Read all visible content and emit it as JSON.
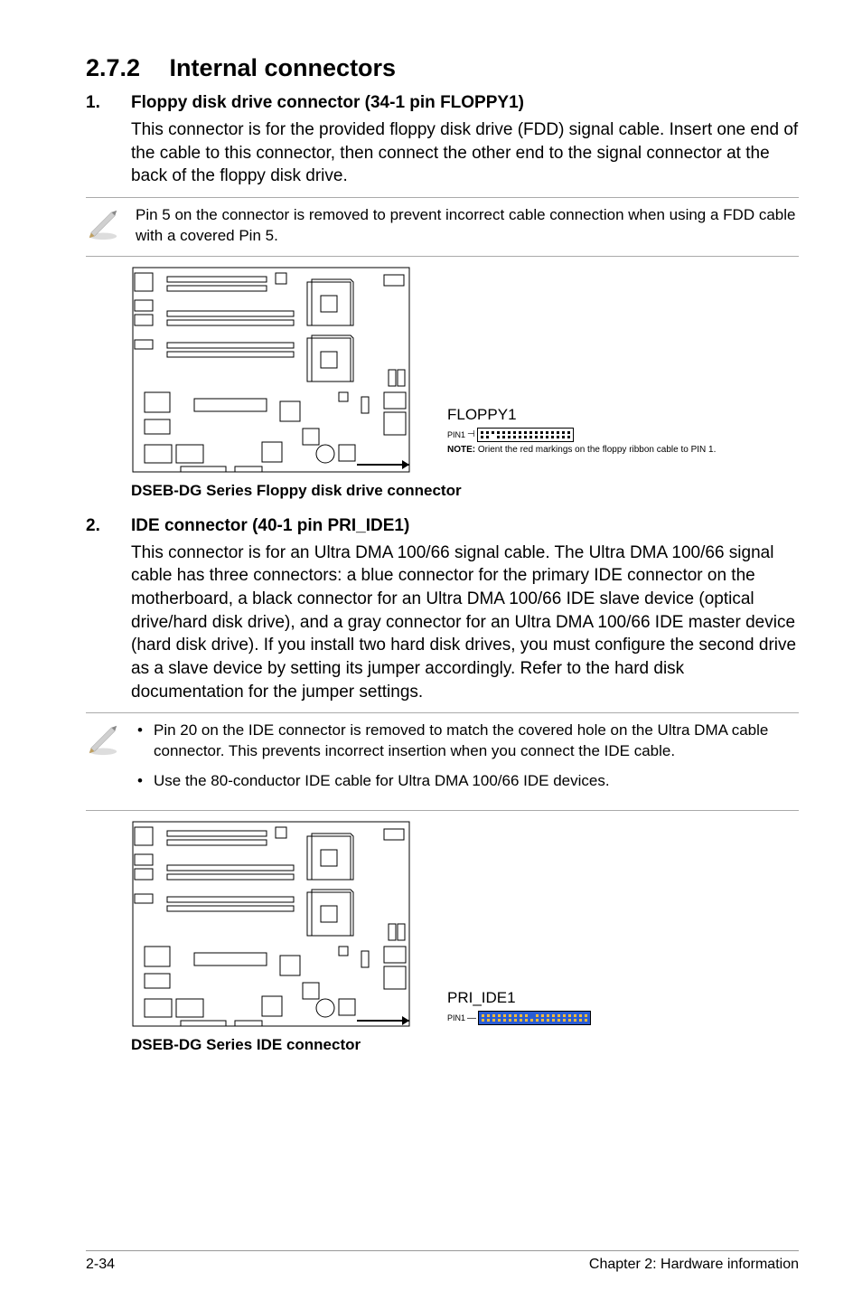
{
  "section": {
    "number": "2.7.2",
    "title": "Internal connectors"
  },
  "item1": {
    "num": "1.",
    "title": "Floppy disk drive connector (34-1 pin FLOPPY1)",
    "body": "This connector is for the provided floppy disk drive (FDD) signal cable. Insert one end of the cable to this connector, then connect the other end to the signal connector at the back of the floppy disk drive.",
    "note": "Pin 5 on the connector is removed to prevent incorrect cable connection when using a FDD cable with a covered Pin 5.",
    "conn_label": "FLOPPY1",
    "pin_label": "PIN1",
    "conn_note_bold": "NOTE:",
    "conn_note_text": " Orient the red markings on the floppy ribbon cable to PIN 1.",
    "caption": "DSEB-DG Series Floppy disk drive connector"
  },
  "item2": {
    "num": "2.",
    "title": "IDE connector (40-1 pin PRI_IDE1)",
    "body": "This connector is for an Ultra DMA 100/66 signal cable. The Ultra DMA 100/66 signal cable has three connectors: a blue connector for the primary IDE connector on the motherboard, a black connector for an Ultra DMA 100/66 IDE slave device (optical drive/hard disk drive), and a gray connector for an Ultra DMA 100/66 IDE master device (hard disk drive). If you install two hard disk drives, you must configure the second drive as a slave device by setting its jumper accordingly. Refer to the hard disk documentation for the jumper settings.",
    "note_li1": "Pin 20 on the IDE connector is removed to match the covered hole on the Ultra DMA cable connector. This prevents incorrect insertion when you connect the IDE cable.",
    "note_li2": "Use the 80-conductor IDE cable for Ultra DMA 100/66 IDE devices.",
    "conn_label": "PRI_IDE1",
    "pin_label": "PIN1",
    "caption": "DSEB-DG Series IDE connector"
  },
  "footer": {
    "left": "2-34",
    "right": "Chapter 2: Hardware information"
  }
}
